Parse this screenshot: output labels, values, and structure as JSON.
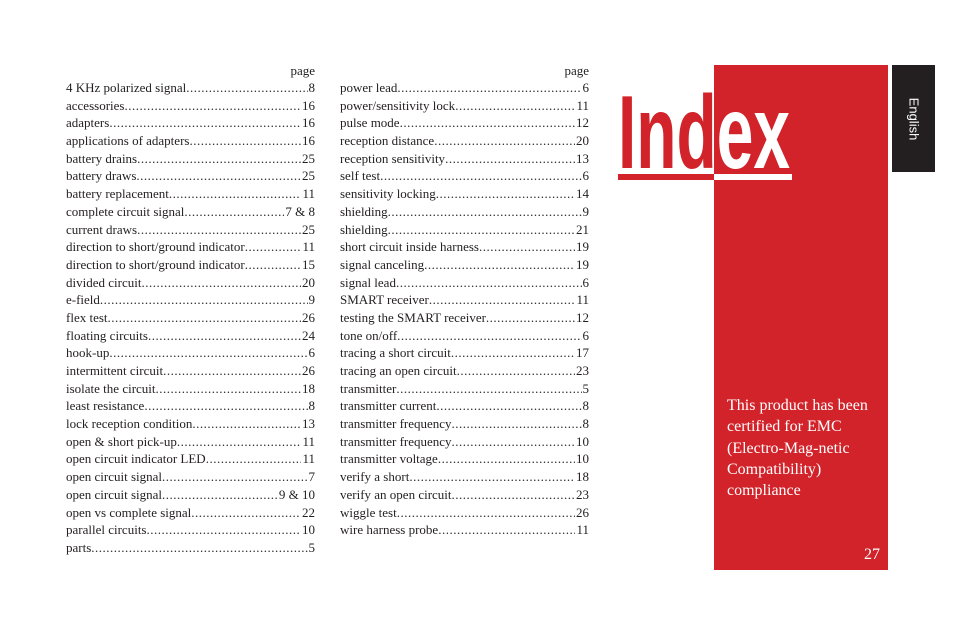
{
  "header": {
    "title": "Index",
    "language_tab": "English",
    "page_column_label": "page"
  },
  "left_column": [
    {
      "term": "4 KHz polarized signal",
      "page": "8"
    },
    {
      "term": "accessories",
      "page": "16"
    },
    {
      "term": "adapters",
      "page": "16"
    },
    {
      "term": "applications of adapters",
      "page": "16"
    },
    {
      "term": "battery drains",
      "page": "25"
    },
    {
      "term": "battery draws",
      "page": "25"
    },
    {
      "term": "battery replacement",
      "page": "11"
    },
    {
      "term": "complete circuit signal",
      "page": "7 & 8"
    },
    {
      "term": "current draws",
      "page": "25"
    },
    {
      "term": "direction to short/ground indicator",
      "page": "11"
    },
    {
      "term": "direction to short/ground indicator",
      "page": "15"
    },
    {
      "term": "divided circuit",
      "page": "20"
    },
    {
      "term": "e-field",
      "page": "9"
    },
    {
      "term": "flex test",
      "page": "26"
    },
    {
      "term": "floating circuits",
      "page": "24"
    },
    {
      "term": "hook-up",
      "page": "6"
    },
    {
      "term": "intermittent circuit",
      "page": "26"
    },
    {
      "term": "isolate the circuit",
      "page": "18"
    },
    {
      "term": "least resistance",
      "page": "8"
    },
    {
      "term": "lock reception condition",
      "page": "13"
    },
    {
      "term": "open & short pick-up",
      "page": "11"
    },
    {
      "term": "open circuit indicator LED",
      "page": "11"
    },
    {
      "term": "open circuit signal",
      "page": "7"
    },
    {
      "term": "open circuit signal",
      "page": "9 & 10"
    },
    {
      "term": "open vs complete signal",
      "page": "22"
    },
    {
      "term": "parallel circuits",
      "page": "10"
    },
    {
      "term": "parts",
      "page": "5"
    }
  ],
  "right_column": [
    {
      "term": "power lead",
      "page": "6"
    },
    {
      "term": "power/sensitivity lock",
      "page": "11"
    },
    {
      "term": "pulse mode",
      "page": "12"
    },
    {
      "term": "reception distance",
      "page": "20"
    },
    {
      "term": "reception sensitivity",
      "page": "13"
    },
    {
      "term": "self test",
      "page": "6"
    },
    {
      "term": "sensitivity locking",
      "page": "14"
    },
    {
      "term": "shielding",
      "page": "9"
    },
    {
      "term": "shielding",
      "page": "21"
    },
    {
      "term": "short circuit inside harness",
      "page": "19"
    },
    {
      "term": "signal canceling",
      "page": "19"
    },
    {
      "term": "signal lead",
      "page": "6"
    },
    {
      "term": "SMART receiver",
      "page": "11"
    },
    {
      "term": "testing the SMART receiver",
      "page": "12"
    },
    {
      "term": "tone on/off",
      "page": "6"
    },
    {
      "term": "tracing a short circuit",
      "page": "17"
    },
    {
      "term": "tracing an open circuit",
      "page": "23"
    },
    {
      "term": "transmitter",
      "page": "5"
    },
    {
      "term": "transmitter current",
      "page": "8"
    },
    {
      "term": "transmitter frequency",
      "page": "8"
    },
    {
      "term": "transmitter frequency",
      "page": "10"
    },
    {
      "term": "transmitter voltage",
      "page": "10"
    },
    {
      "term": "verify a short",
      "page": "18"
    },
    {
      "term": "verify an open circuit",
      "page": "23"
    },
    {
      "term": "wiggle test",
      "page": "26"
    },
    {
      "term": "wire harness probe",
      "page": "11"
    }
  ],
  "panel": {
    "certification": "This product has been certified for EMC (Electro-Mag-netic Compatibility) compliance",
    "page_number": "27"
  },
  "colors": {
    "accent_red": "#d2232a",
    "tab_black": "#231f20"
  }
}
